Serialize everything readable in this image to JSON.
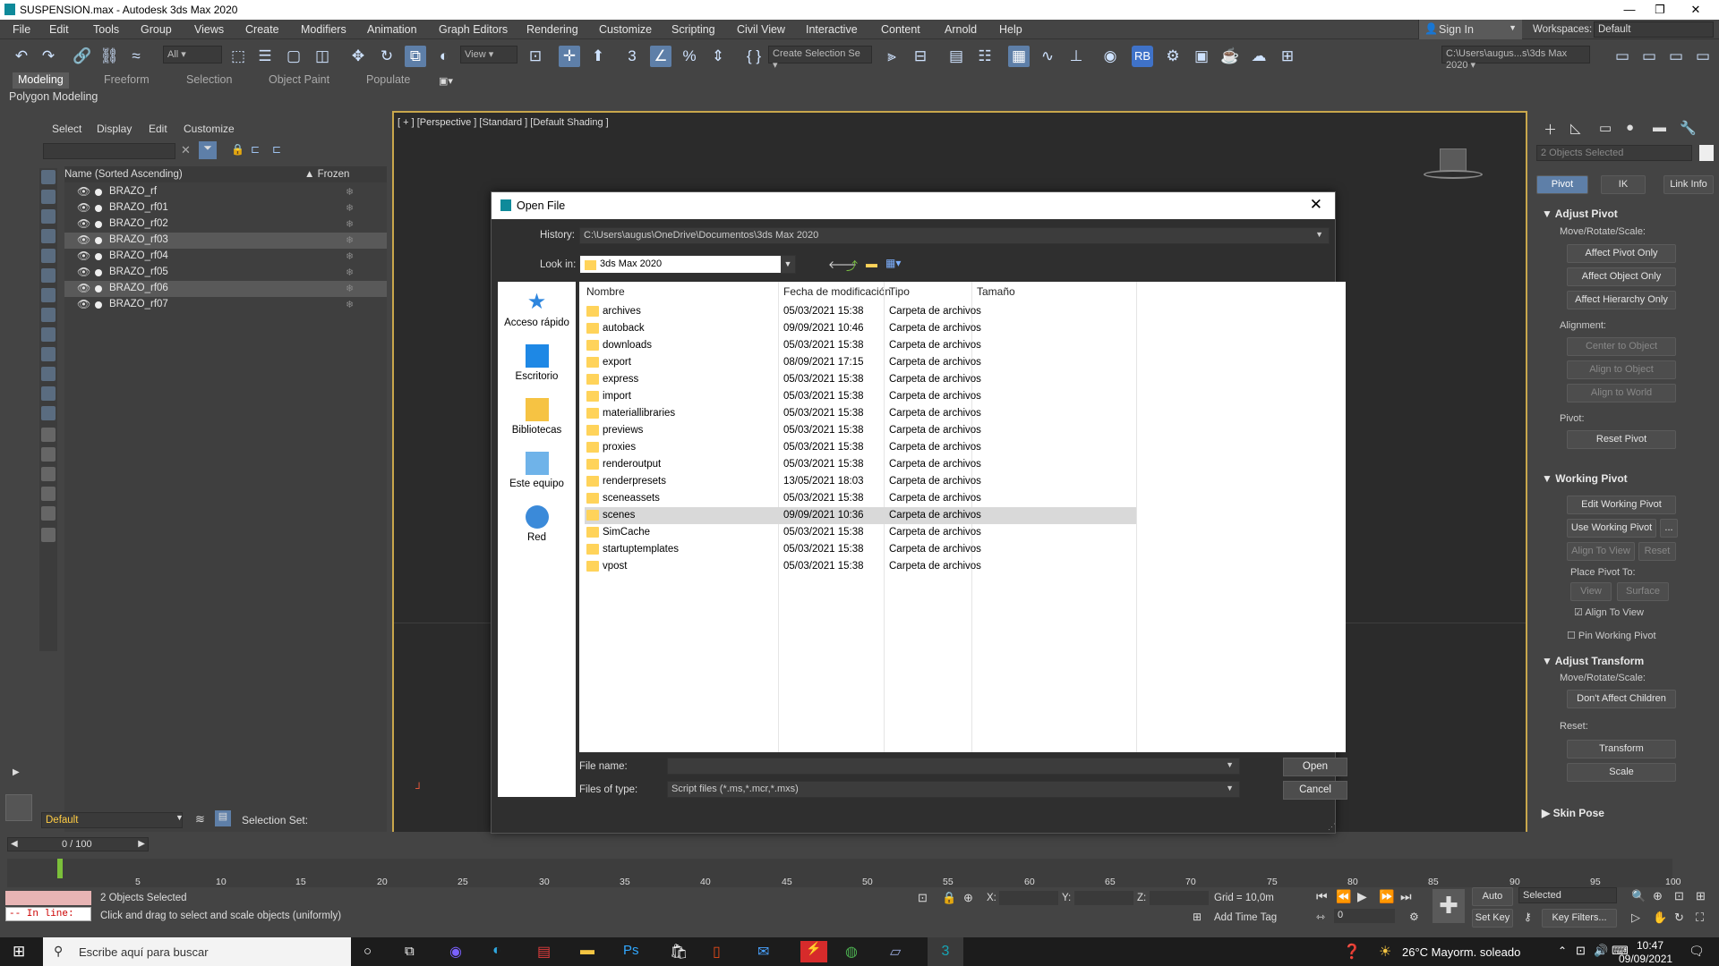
{
  "window": {
    "title": "SUSPENSION.max - Autodesk 3ds Max 2020",
    "minimize": "—",
    "maximize": "❐",
    "close": "✕"
  },
  "menu": [
    "File",
    "Edit",
    "Tools",
    "Group",
    "Views",
    "Create",
    "Modifiers",
    "Animation",
    "Graph Editors",
    "Rendering",
    "Customize",
    "Scripting",
    "Civil View",
    "Interactive",
    "Content",
    "Arnold",
    "Help"
  ],
  "signin": "Sign In",
  "workspaces": {
    "label": "Workspaces:",
    "value": "Default"
  },
  "toolbar": {
    "filter": "All",
    "view": "View",
    "create_selection": "Create Selection Se",
    "path": "C:\\Users\\augus...s\\3ds Max 2020",
    "rb": "RB"
  },
  "ribbon": {
    "tabs": [
      "Modeling",
      "Freeform",
      "Selection",
      "Object Paint",
      "Populate"
    ],
    "sub": "Polygon Modeling"
  },
  "scene_explorer": {
    "menu": [
      "Select",
      "Display",
      "Edit",
      "Customize"
    ],
    "col_name": "Name (Sorted Ascending)",
    "col_frozen": "▲ Frozen",
    "items": [
      "BRAZO_rf",
      "BRAZO_rf01",
      "BRAZO_rf02",
      "BRAZO_rf03",
      "BRAZO_rf04",
      "BRAZO_rf05",
      "BRAZO_rf06",
      "BRAZO_rf07"
    ],
    "layer": "Default",
    "selection_set": "Selection Set:"
  },
  "viewport": {
    "label": "[ + ] [Perspective ] [Standard ] [Default Shading ]"
  },
  "command_panel": {
    "objects_selected": "2 Objects Selected",
    "tabs": [
      "Pivot",
      "IK",
      "Link Info"
    ],
    "adjust_pivot": "Adjust Pivot",
    "move_rotate_scale": "Move/Rotate/Scale:",
    "affect_pivot": "Affect Pivot Only",
    "affect_object": "Affect Object Only",
    "affect_hierarchy": "Affect Hierarchy Only",
    "alignment": "Alignment:",
    "center_to_object": "Center to Object",
    "align_to_object": "Align to Object",
    "align_to_world": "Align to World",
    "pivot": "Pivot:",
    "reset_pivot": "Reset Pivot",
    "working_pivot": "Working Pivot",
    "edit_working_pivot": "Edit Working Pivot",
    "use_working_pivot": "Use Working Pivot",
    "dots": "...",
    "align_to_view": "Align To View",
    "reset": "Reset",
    "place_pivot_to": "Place Pivot To:",
    "view": "View",
    "surface": "Surface",
    "align_to_view_chk": "Align To View",
    "pin_working_pivot": "Pin Working Pivot",
    "adjust_transform": "Adjust Transform",
    "move_rotate_scale2": "Move/Rotate/Scale:",
    "dont_affect_children": "Don't Affect Children",
    "reset2": "Reset:",
    "transform": "Transform",
    "scale": "Scale",
    "skin_pose": "Skin Pose"
  },
  "timeline": {
    "frame": "0 / 100",
    "ticks": [
      "5",
      "10",
      "15",
      "20",
      "25",
      "30",
      "35",
      "40",
      "45",
      "50",
      "55",
      "60",
      "65",
      "70",
      "75",
      "80",
      "85",
      "90",
      "95",
      "100"
    ]
  },
  "status": {
    "selected": "2 Objects Selected",
    "prompt": "Click and drag to select and scale objects (uniformly)",
    "in_line": "-- In line:",
    "x": "X:",
    "y": "Y:",
    "z": "Z:",
    "grid": "Grid = 10,0m",
    "add_time_tag": "Add Time Tag",
    "auto_key": "Auto Key",
    "set_key": "Set Key",
    "selected_mode": "Selected",
    "key_filters": "Key Filters...",
    "frame_value": "0"
  },
  "taskbar": {
    "search": "Escribe aquí para buscar",
    "weather": "26°C  Mayorm. soleado",
    "time": "10:47",
    "date": "09/09/2021"
  },
  "dialog": {
    "title": "Open File",
    "history_label": "History:",
    "history_value": "C:\\Users\\augus\\OneDrive\\Documentos\\3ds Max 2020",
    "lookin_label": "Look in:",
    "lookin_value": "3ds Max 2020",
    "places": [
      "Acceso rápido",
      "Escritorio",
      "Bibliotecas",
      "Este equipo",
      "Red"
    ],
    "columns": [
      "Nombre",
      "Fecha de modificación",
      "Tipo",
      "Tamaño"
    ],
    "files": [
      {
        "name": "archives",
        "date": "05/03/2021 15:38",
        "type": "Carpeta de archivos"
      },
      {
        "name": "autoback",
        "date": "09/09/2021 10:46",
        "type": "Carpeta de archivos"
      },
      {
        "name": "downloads",
        "date": "05/03/2021 15:38",
        "type": "Carpeta de archivos"
      },
      {
        "name": "export",
        "date": "08/09/2021 17:15",
        "type": "Carpeta de archivos"
      },
      {
        "name": "express",
        "date": "05/03/2021 15:38",
        "type": "Carpeta de archivos"
      },
      {
        "name": "import",
        "date": "05/03/2021 15:38",
        "type": "Carpeta de archivos"
      },
      {
        "name": "materiallibraries",
        "date": "05/03/2021 15:38",
        "type": "Carpeta de archivos"
      },
      {
        "name": "previews",
        "date": "05/03/2021 15:38",
        "type": "Carpeta de archivos"
      },
      {
        "name": "proxies",
        "date": "05/03/2021 15:38",
        "type": "Carpeta de archivos"
      },
      {
        "name": "renderoutput",
        "date": "05/03/2021 15:38",
        "type": "Carpeta de archivos"
      },
      {
        "name": "renderpresets",
        "date": "13/05/2021 18:03",
        "type": "Carpeta de archivos"
      },
      {
        "name": "sceneassets",
        "date": "05/03/2021 15:38",
        "type": "Carpeta de archivos"
      },
      {
        "name": "scenes",
        "date": "09/09/2021 10:36",
        "type": "Carpeta de archivos"
      },
      {
        "name": "SimCache",
        "date": "05/03/2021 15:38",
        "type": "Carpeta de archivos"
      },
      {
        "name": "startuptemplates",
        "date": "05/03/2021 15:38",
        "type": "Carpeta de archivos"
      },
      {
        "name": "vpost",
        "date": "05/03/2021 15:38",
        "type": "Carpeta de archivos"
      }
    ],
    "filename_label": "File name:",
    "filename_value": "",
    "filetype_label": "Files of type:",
    "filetype_value": "Script files (*.ms,*.mcr,*.mxs)",
    "open": "Open",
    "cancel": "Cancel"
  },
  "colors": {
    "accent": "#5e7fa8",
    "viewport_border": "#c9a74c",
    "folder": "#ffd35a"
  }
}
